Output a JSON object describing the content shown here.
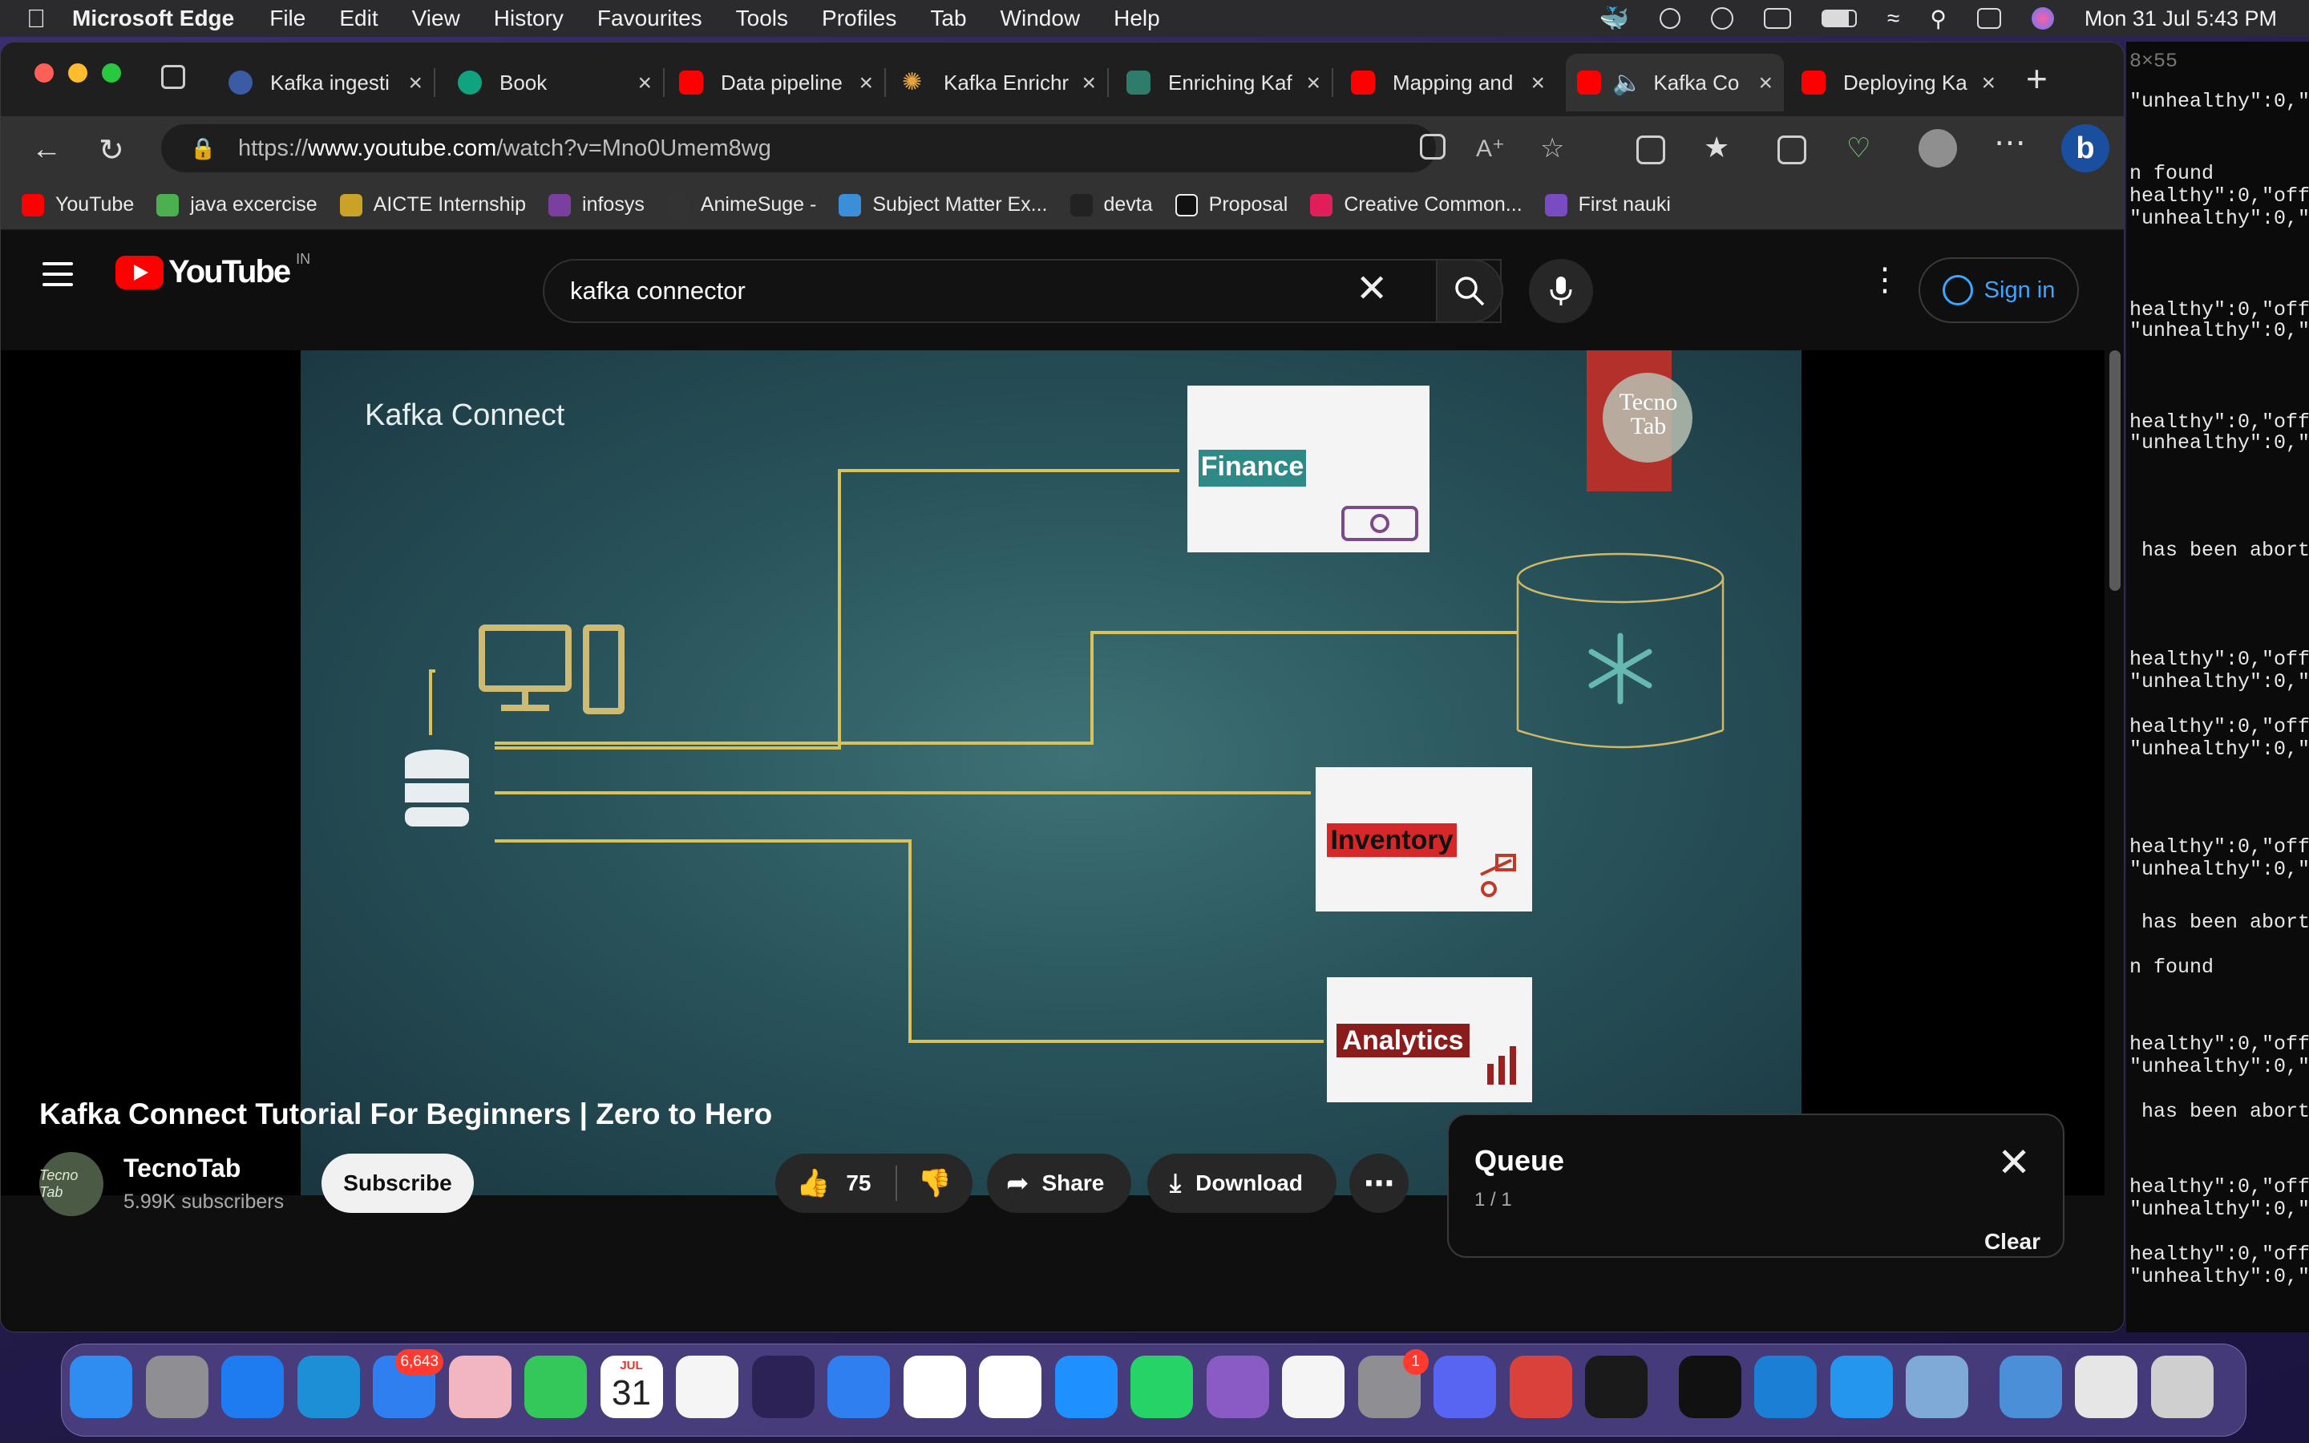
{
  "menubar": {
    "app": "Microsoft Edge",
    "items": [
      "File",
      "Edit",
      "View",
      "History",
      "Favourites",
      "Tools",
      "Profiles",
      "Tab",
      "Window",
      "Help"
    ],
    "datetime": "Mon 31 Jul  5:43 PM"
  },
  "browser": {
    "tabs": [
      {
        "label": "Kafka ingesti",
        "favicon_color": "#3b5ba5"
      },
      {
        "label": "Book",
        "favicon_color": "#0fa37f"
      },
      {
        "label": "Data pipeline",
        "favicon_color": "#ff0000"
      },
      {
        "label": "Kafka Enrichr",
        "favicon_color": "#e8a33d"
      },
      {
        "label": "Enriching Kaf",
        "favicon_color": "#2e7d6a"
      },
      {
        "label": "Mapping and",
        "favicon_color": "#ff0000"
      },
      {
        "label": "Kafka Co",
        "favicon_color": "#ff0000"
      },
      {
        "label": "Deploying Ka",
        "favicon_color": "#ff0000"
      }
    ],
    "url_prefix": "https://",
    "url_domain": "www.youtube.com",
    "url_path": "/watch?v=Mno0Umem8wg",
    "bookmarks": [
      {
        "label": "YouTube",
        "color": "#ff0000"
      },
      {
        "label": "java excercise",
        "color": "#4caf50"
      },
      {
        "label": "AICTE Internship",
        "color": "#c9a227"
      },
      {
        "label": "infosys",
        "color": "#7b3fa0"
      },
      {
        "label": "AnimeSuge -",
        "color": "#333333"
      },
      {
        "label": "Subject Matter Ex...",
        "color": "#3b8fd9"
      },
      {
        "label": "devta",
        "color": "#222222"
      },
      {
        "label": "Proposal",
        "color": "#111111"
      },
      {
        "label": "Creative Common...",
        "color": "#e01e5a"
      },
      {
        "label": "First nauki",
        "color": "#7a4cc2"
      }
    ]
  },
  "youtube": {
    "logo_text": "YouTube",
    "country_code": "IN",
    "search_query": "kafka connector",
    "sign_in": "Sign in",
    "video": {
      "slide_title": "Kafka Connect",
      "watermark": "Tecno Tab",
      "targets": [
        "Finance",
        "Inventory",
        "Analytics"
      ]
    },
    "title": "Kafka Connect Tutorial For Beginners | Zero to Hero",
    "channel": {
      "name": "TecnoTab",
      "subscribers": "5.99K subscribers",
      "avatar_text": "Tecno Tab"
    },
    "subscribe": "Subscribe",
    "likes": "75",
    "share": "Share",
    "download": "Download",
    "queue": {
      "title": "Queue",
      "count": "1 / 1",
      "clear": "Clear"
    }
  },
  "terminal": {
    "header": "8×55",
    "lines": [
      "\"unhealthy\":0,\"o",
      "n found",
      "healthy\":0,\"offl",
      "\"unhealthy\":0,\"o",
      "healthy\":0,\"offl",
      "\"unhealthy\":0,\"o",
      "healthy\":0,\"offl",
      "\"unhealthy\":0,\"o",
      " has been aborte",
      "healthy\":0,\"offl",
      "\"unhealthy\":0,\"o",
      "healthy\":0,\"offl",
      "\"unhealthy\":0,\"o",
      "healthy\":0,\"offl",
      "\"unhealthy\":0,\"o",
      " has been aborte",
      "n found",
      "healthy\":0,\"offl",
      "\"unhealthy\":0,\"o",
      " has been aborte",
      "healthy\":0,\"offl",
      "\"unhealthy\":0,\"o",
      "healthy\":0,\"offl",
      "\"unhealthy\":0,\"o"
    ]
  },
  "dock": {
    "mail_badge": "6,643",
    "calendar_month": "JUL",
    "calendar_day": "31",
    "settings_badge": "1",
    "apps": [
      {
        "name": "finder",
        "color": "#2f8cf0"
      },
      {
        "name": "launchpad",
        "color": "#8e8e93"
      },
      {
        "name": "safari",
        "color": "#1f7cf0"
      },
      {
        "name": "edge",
        "color": "#1d8fd6"
      },
      {
        "name": "mail",
        "color": "#2f7ff0"
      },
      {
        "name": "photos",
        "color": "#f2b6c0"
      },
      {
        "name": "facetime",
        "color": "#34c759"
      },
      {
        "name": "calendar",
        "color": "#ffffff"
      },
      {
        "name": "reminders",
        "color": "#f5f5f5"
      },
      {
        "name": "eclipse",
        "color": "#2c2255"
      },
      {
        "name": "keynote",
        "color": "#2f7ff0"
      },
      {
        "name": "pages",
        "color": "#ffffff"
      },
      {
        "name": "numbers",
        "color": "#ffffff"
      },
      {
        "name": "app-store",
        "color": "#1e90ff"
      },
      {
        "name": "whatsapp",
        "color": "#25d366"
      },
      {
        "name": "github-desktop",
        "color": "#8a5bc4"
      },
      {
        "name": "freeform",
        "color": "#f5f5f5"
      },
      {
        "name": "system-settings",
        "color": "#8e8e93"
      },
      {
        "name": "discord",
        "color": "#5865f2"
      },
      {
        "name": "photo-booth",
        "color": "#d9413b"
      },
      {
        "name": "activity-monitor",
        "color": "#1a1a1a"
      },
      {
        "name": "terminal",
        "color": "#111111"
      },
      {
        "name": "vscode",
        "color": "#1c7fd6"
      },
      {
        "name": "docker",
        "color": "#2496ed"
      },
      {
        "name": "preview",
        "color": "#7fa9d6"
      },
      {
        "name": "downloads-stack",
        "color": "#4a8fd8"
      },
      {
        "name": "recent-stack",
        "color": "#e6e6e6"
      },
      {
        "name": "trash",
        "color": "#cfcfcf"
      }
    ]
  }
}
